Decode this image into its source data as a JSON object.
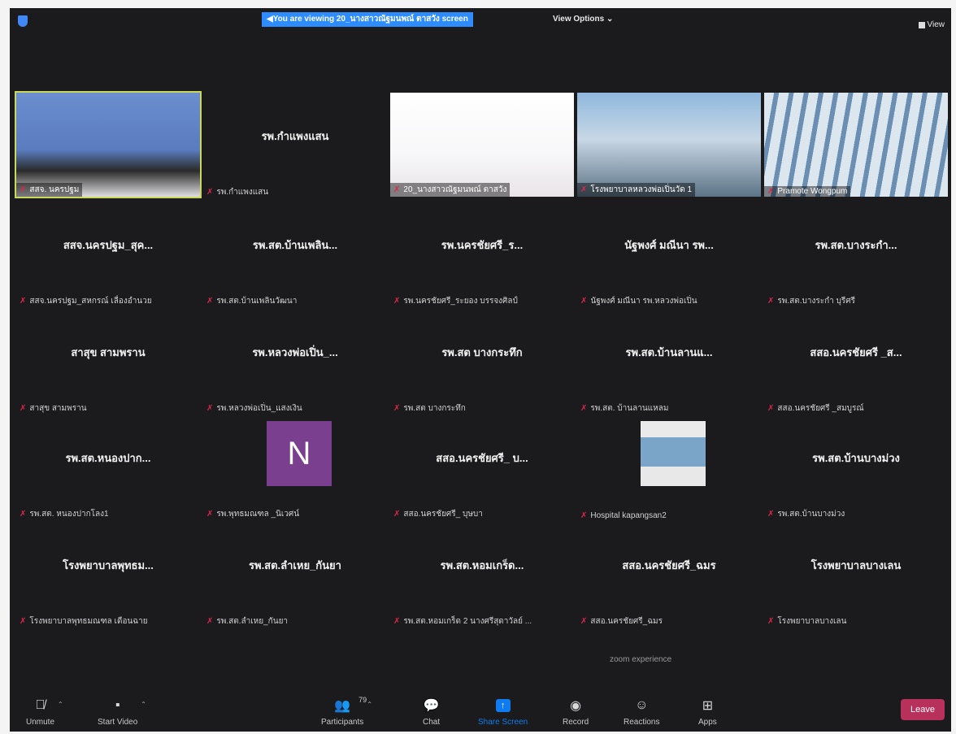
{
  "topbar": {
    "banner": "You are viewing 20_นางสาวณัฐมนพณ์ ตาสวัง screen",
    "view_options": "View Options ⌄",
    "view_label": "View"
  },
  "gallery": {
    "rows": [
      [
        {
          "type": "video",
          "label": "สสจ. นครปฐม",
          "active": true
        },
        {
          "type": "name",
          "name": "รพ.กำแพงแสน",
          "label": "รพ.กำแพงแสน"
        },
        {
          "type": "video",
          "label": "20_นางสาวณัฐมนพณ์ ตาสวัง"
        },
        {
          "type": "video",
          "label": "โรงพยาบาลหลวงพ่อเปิ่นวัด 1"
        },
        {
          "type": "video",
          "label": "Pramote Wongpum"
        }
      ],
      [
        {
          "type": "name",
          "name": "สสจ.นครปฐม_สุค...",
          "label": "สสจ.นครปฐม_สหกรณ์ เลื่องอำนวย"
        },
        {
          "type": "name",
          "name": "รพ.สต.บ้านเพลิน...",
          "label": "รพ.สต.บ้านเพลินวัฒนา"
        },
        {
          "type": "name",
          "name": "รพ.นครชัยศรี_ร...",
          "label": "รพ.นครชัยศรี_ระยอง บรรจงศิลป์"
        },
        {
          "type": "name",
          "name": "นัฐพงศ์ มณีนา รพ...",
          "label": "นัฐพงศ์ มณีนา รพ.หลวงพ่อเปิ่น"
        },
        {
          "type": "name",
          "name": "รพ.สต.บางระกำ...",
          "label": "รพ.สต.บางระกำ บุรีศรี"
        }
      ],
      [
        {
          "type": "name",
          "name": "สาสุข สามพราน",
          "label": "สาสุข สามพราน"
        },
        {
          "type": "name",
          "name": "รพ.หลวงพ่อเปิ่น_...",
          "label": "รพ.หลวงพ่อเปิ่น_แสงเงิน"
        },
        {
          "type": "name",
          "name": "รพ.สต บางกระทึก",
          "label": "รพ.สต บางกระทึก"
        },
        {
          "type": "name",
          "name": "รพ.สต.บ้านลานแ...",
          "label": "รพ.สต. บ้านลานแหลม"
        },
        {
          "type": "name",
          "name": "สสอ.นครชัยศรี _ส...",
          "label": "สสอ.นครชัยศรี _สมบูรณ์"
        }
      ],
      [
        {
          "type": "name",
          "name": "รพ.สต.หนองปาก...",
          "label": "รพ.สต. หนองปากโลง1"
        },
        {
          "type": "avatar",
          "letter": "N",
          "label": "รพ.พุทธมณฑล _นิเวศน์"
        },
        {
          "type": "name",
          "name": "สสอ.นครชัยศรี_ บ...",
          "label": "สสอ.นครชัยศรี_ บุษบา"
        },
        {
          "type": "image",
          "label": "Hospital kapangsan2"
        },
        {
          "type": "name",
          "name": "รพ.สต.บ้านบางม่วง",
          "label": "รพ.สต.บ้านบางม่วง"
        }
      ],
      [
        {
          "type": "name",
          "name": "โรงพยาบาลพุทธม...",
          "label": "โรงพยาบาลพุทธมณฑล เดือนฉาย"
        },
        {
          "type": "name",
          "name": "รพ.สต.ลำเหย_กันยา",
          "label": "รพ.สต.ลำเหย_กันยา"
        },
        {
          "type": "name",
          "name": "รพ.สต.หอมเกร็ด...",
          "label": "รพ.สต.หอมเกร็ด 2 นางศรีสุดาวัลย์ ..."
        },
        {
          "type": "name",
          "name": "สสอ.นครชัยศรี_ฉมร",
          "label": "สสอ.นครชัยศรี_ฉมร"
        },
        {
          "type": "name",
          "name": "โรงพยาบาลบางเลน",
          "label": "โรงพยาบาลบางเลน"
        }
      ]
    ]
  },
  "footer_text": "zoom experience",
  "controls": {
    "unmute": "Unmute",
    "start_video": "Start Video",
    "participants": "Participants",
    "participants_count": "79",
    "chat": "Chat",
    "share_screen": "Share Screen",
    "record": "Record",
    "reactions": "Reactions",
    "apps": "Apps",
    "leave": "Leave"
  }
}
